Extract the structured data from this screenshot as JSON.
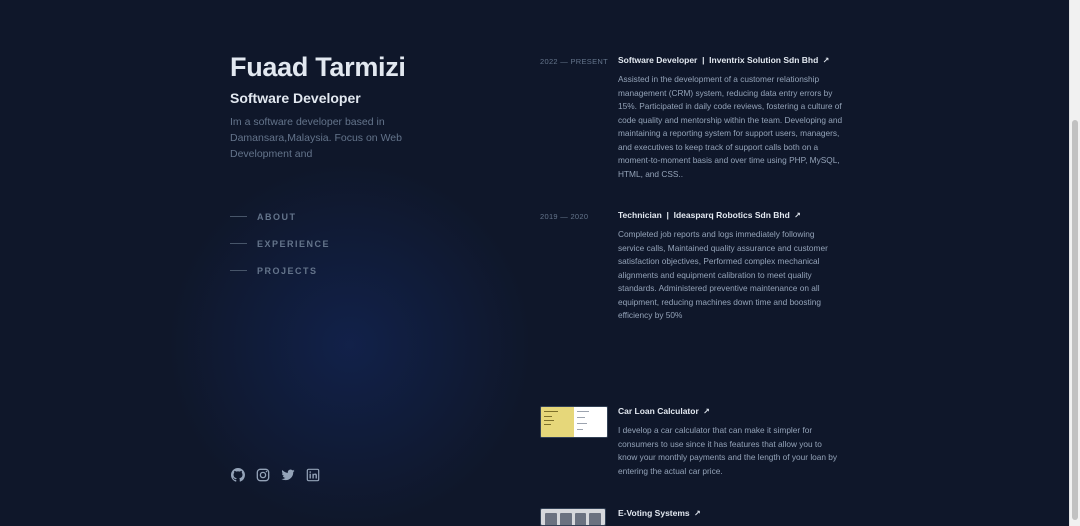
{
  "profile": {
    "name": "Fuaad Tarmizi",
    "role": "Software Developer",
    "bio": "Im a software developer based in Damansara,Malaysia. Focus on Web Development and"
  },
  "nav": {
    "items": [
      {
        "label": "ABOUT"
      },
      {
        "label": "EXPERIENCE"
      },
      {
        "label": "PROJECTS"
      }
    ]
  },
  "socials": {
    "icons": [
      "github-icon",
      "instagram-icon",
      "twitter-icon",
      "linkedin-icon"
    ]
  },
  "experience": [
    {
      "date": "2022 — PRESENT",
      "title": "Software Developer  |  Inventrix Solution Sdn Bhd",
      "arrow": "↗",
      "description": "Assisted in the development of a customer relationship management (CRM) system, reducing data entry errors by 15%. Participated in daily code reviews, fostering a culture of code quality and mentorship within the team. Developing and maintaining a reporting system for support users, managers, and executives to keep track of support calls both on a moment-to-moment basis and over time using PHP, MySQL, HTML, and CSS.."
    },
    {
      "date": "2019 — 2020",
      "title": "Technician  |  Ideasparq Robotics Sdn Bhd",
      "arrow": "↗",
      "description": "Completed job reports and logs immediately following service calls, Maintained quality assurance and customer satisfaction objectives, Performed complex mechanical alignments and equipment calibration to meet quality standards. Administered preventive maintenance on all equipment, reducing machines down time and boosting efficiency by 50%"
    }
  ],
  "projects": [
    {
      "title": "Car Loan Calculator",
      "arrow": "↗",
      "description": "I develop a car calculator that can make it simpler for consumers to use since it has features that allow you to know your monthly payments and the length of your loan by entering the actual car price."
    },
    {
      "title": "E-Voting Systems",
      "arrow": "↗"
    }
  ],
  "colors": {
    "background": "#0f172a",
    "heading": "#e2e8f0",
    "body_text": "#94a3b8",
    "muted": "#64748b"
  }
}
